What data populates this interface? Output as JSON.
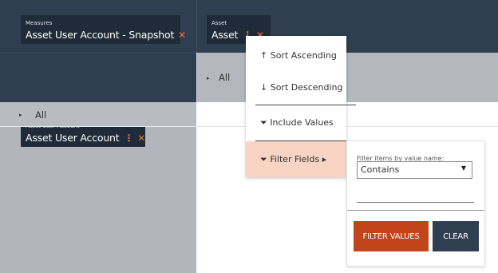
{
  "left": {
    "measures_pill": {
      "small_label": "Measures",
      "value": "Asset User Account - Snapshot",
      "close_glyph": "✕"
    },
    "row_pill": {
      "small_label": "Asset User Account",
      "value": "Asset User Account",
      "menu_glyph": "⋮",
      "close_glyph": "✕"
    },
    "all_row": {
      "expander_glyph": "▸",
      "label": "All"
    }
  },
  "right": {
    "column_pill": {
      "small_label": "Asset",
      "value": "Asset",
      "menu_glyph": "⋮",
      "close_glyph": "✕"
    },
    "all_row": {
      "expander_glyph": "▸",
      "label": "All"
    }
  },
  "menu": {
    "sort_ascending": {
      "icon": "↑",
      "label": "Sort Ascending"
    },
    "sort_descending": {
      "icon": "↓",
      "label": "Sort Descending"
    },
    "include_values": {
      "icon": "⏷",
      "label": "Include Values"
    },
    "filter_fields": {
      "icon": "⏷",
      "label": "Filter Fields",
      "submenu_glyph": "▸"
    }
  },
  "filter_panel": {
    "label": "Filter items by value name:",
    "operator_selected": "Contains",
    "operator_arrow": "▼",
    "value": "",
    "filter_button": "FILTER VALUES",
    "clear_button": "CLEAR"
  },
  "colors": {
    "header_bg": "#2f3f51",
    "pill_bg": "#1f2b38",
    "accent": "#f06a35",
    "filter_button": "#c1441a",
    "menu_highlight": "#f9d3c3"
  }
}
